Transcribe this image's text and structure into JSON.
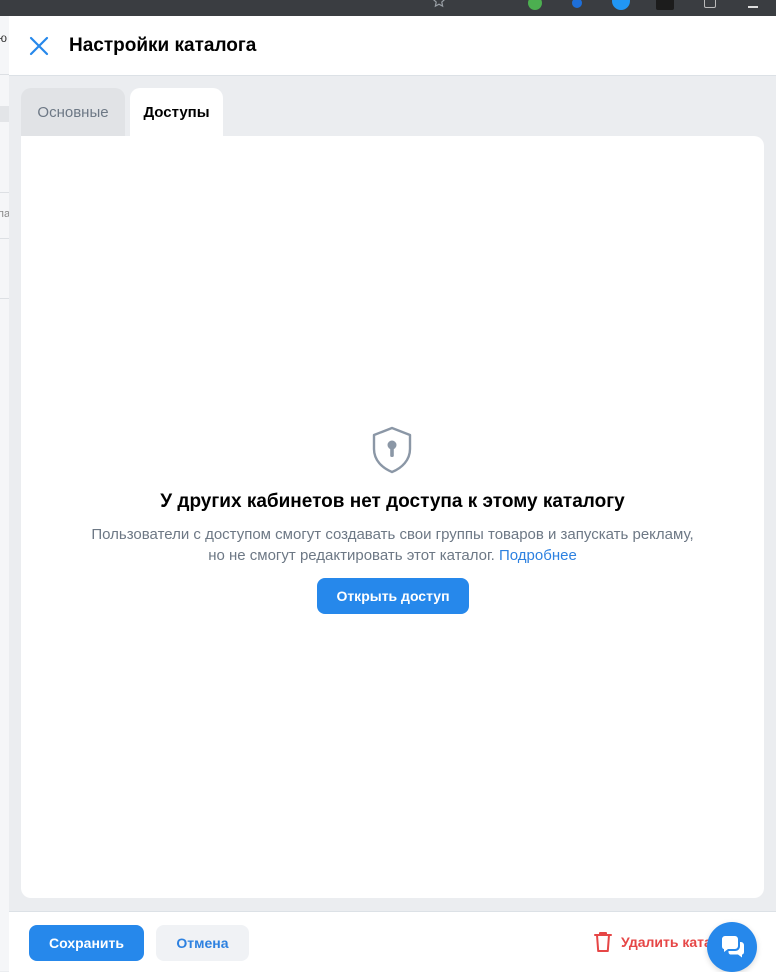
{
  "under_page": {
    "fragment_top": "ю",
    "fragment_mid": "па"
  },
  "modal": {
    "title": "Настройки каталога",
    "tabs": [
      {
        "label": "Основные",
        "active": false
      },
      {
        "label": "Доступы",
        "active": true
      }
    ],
    "empty_state": {
      "icon": "shield-lock-icon",
      "title": "У других кабинетов нет доступа к этому каталогу",
      "description_line1": "Пользователи с доступом смогут создавать свои группы товаров и запускать рекламу,",
      "description_line2": "но не смогут редактировать этот каталог.",
      "link_label": "Подробнее",
      "button_label": "Открыть доступ"
    },
    "footer": {
      "save_label": "Сохранить",
      "cancel_label": "Отмена",
      "delete_label": "Удалить каталог"
    }
  },
  "colors": {
    "accent": "#2688eb",
    "link": "#2d81e0",
    "danger": "#e64646",
    "muted": "#6d7885"
  }
}
